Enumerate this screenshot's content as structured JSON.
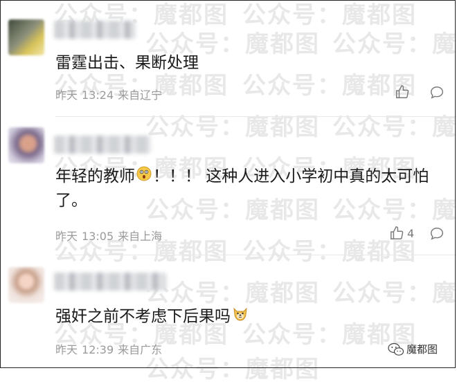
{
  "watermark_text": "公众号：魔都图",
  "comments": [
    {
      "text": "雷霆出击、果断处理",
      "date": "昨天",
      "time": "13:24",
      "location": "来自辽宁",
      "likes": ""
    },
    {
      "text_before": "年轻的教师",
      "text_after": "！！！ 这种人进入小学初中真的太可怕了。",
      "emoji": "shocked-face",
      "date": "昨天",
      "time": "13:05",
      "location": "来自上海",
      "likes": "4"
    },
    {
      "text": "强奸之前不考虑下后果吗",
      "emoji": "dog-face",
      "date": "昨天",
      "time": "12:39",
      "location": "来自广东",
      "likes": ""
    }
  ],
  "brand": {
    "label": "魔都图",
    "icon": "wechat-icon"
  },
  "colors": {
    "meta": "#9a9a9a",
    "text": "#1a1a1a",
    "watermark": "#cfcfcf"
  }
}
